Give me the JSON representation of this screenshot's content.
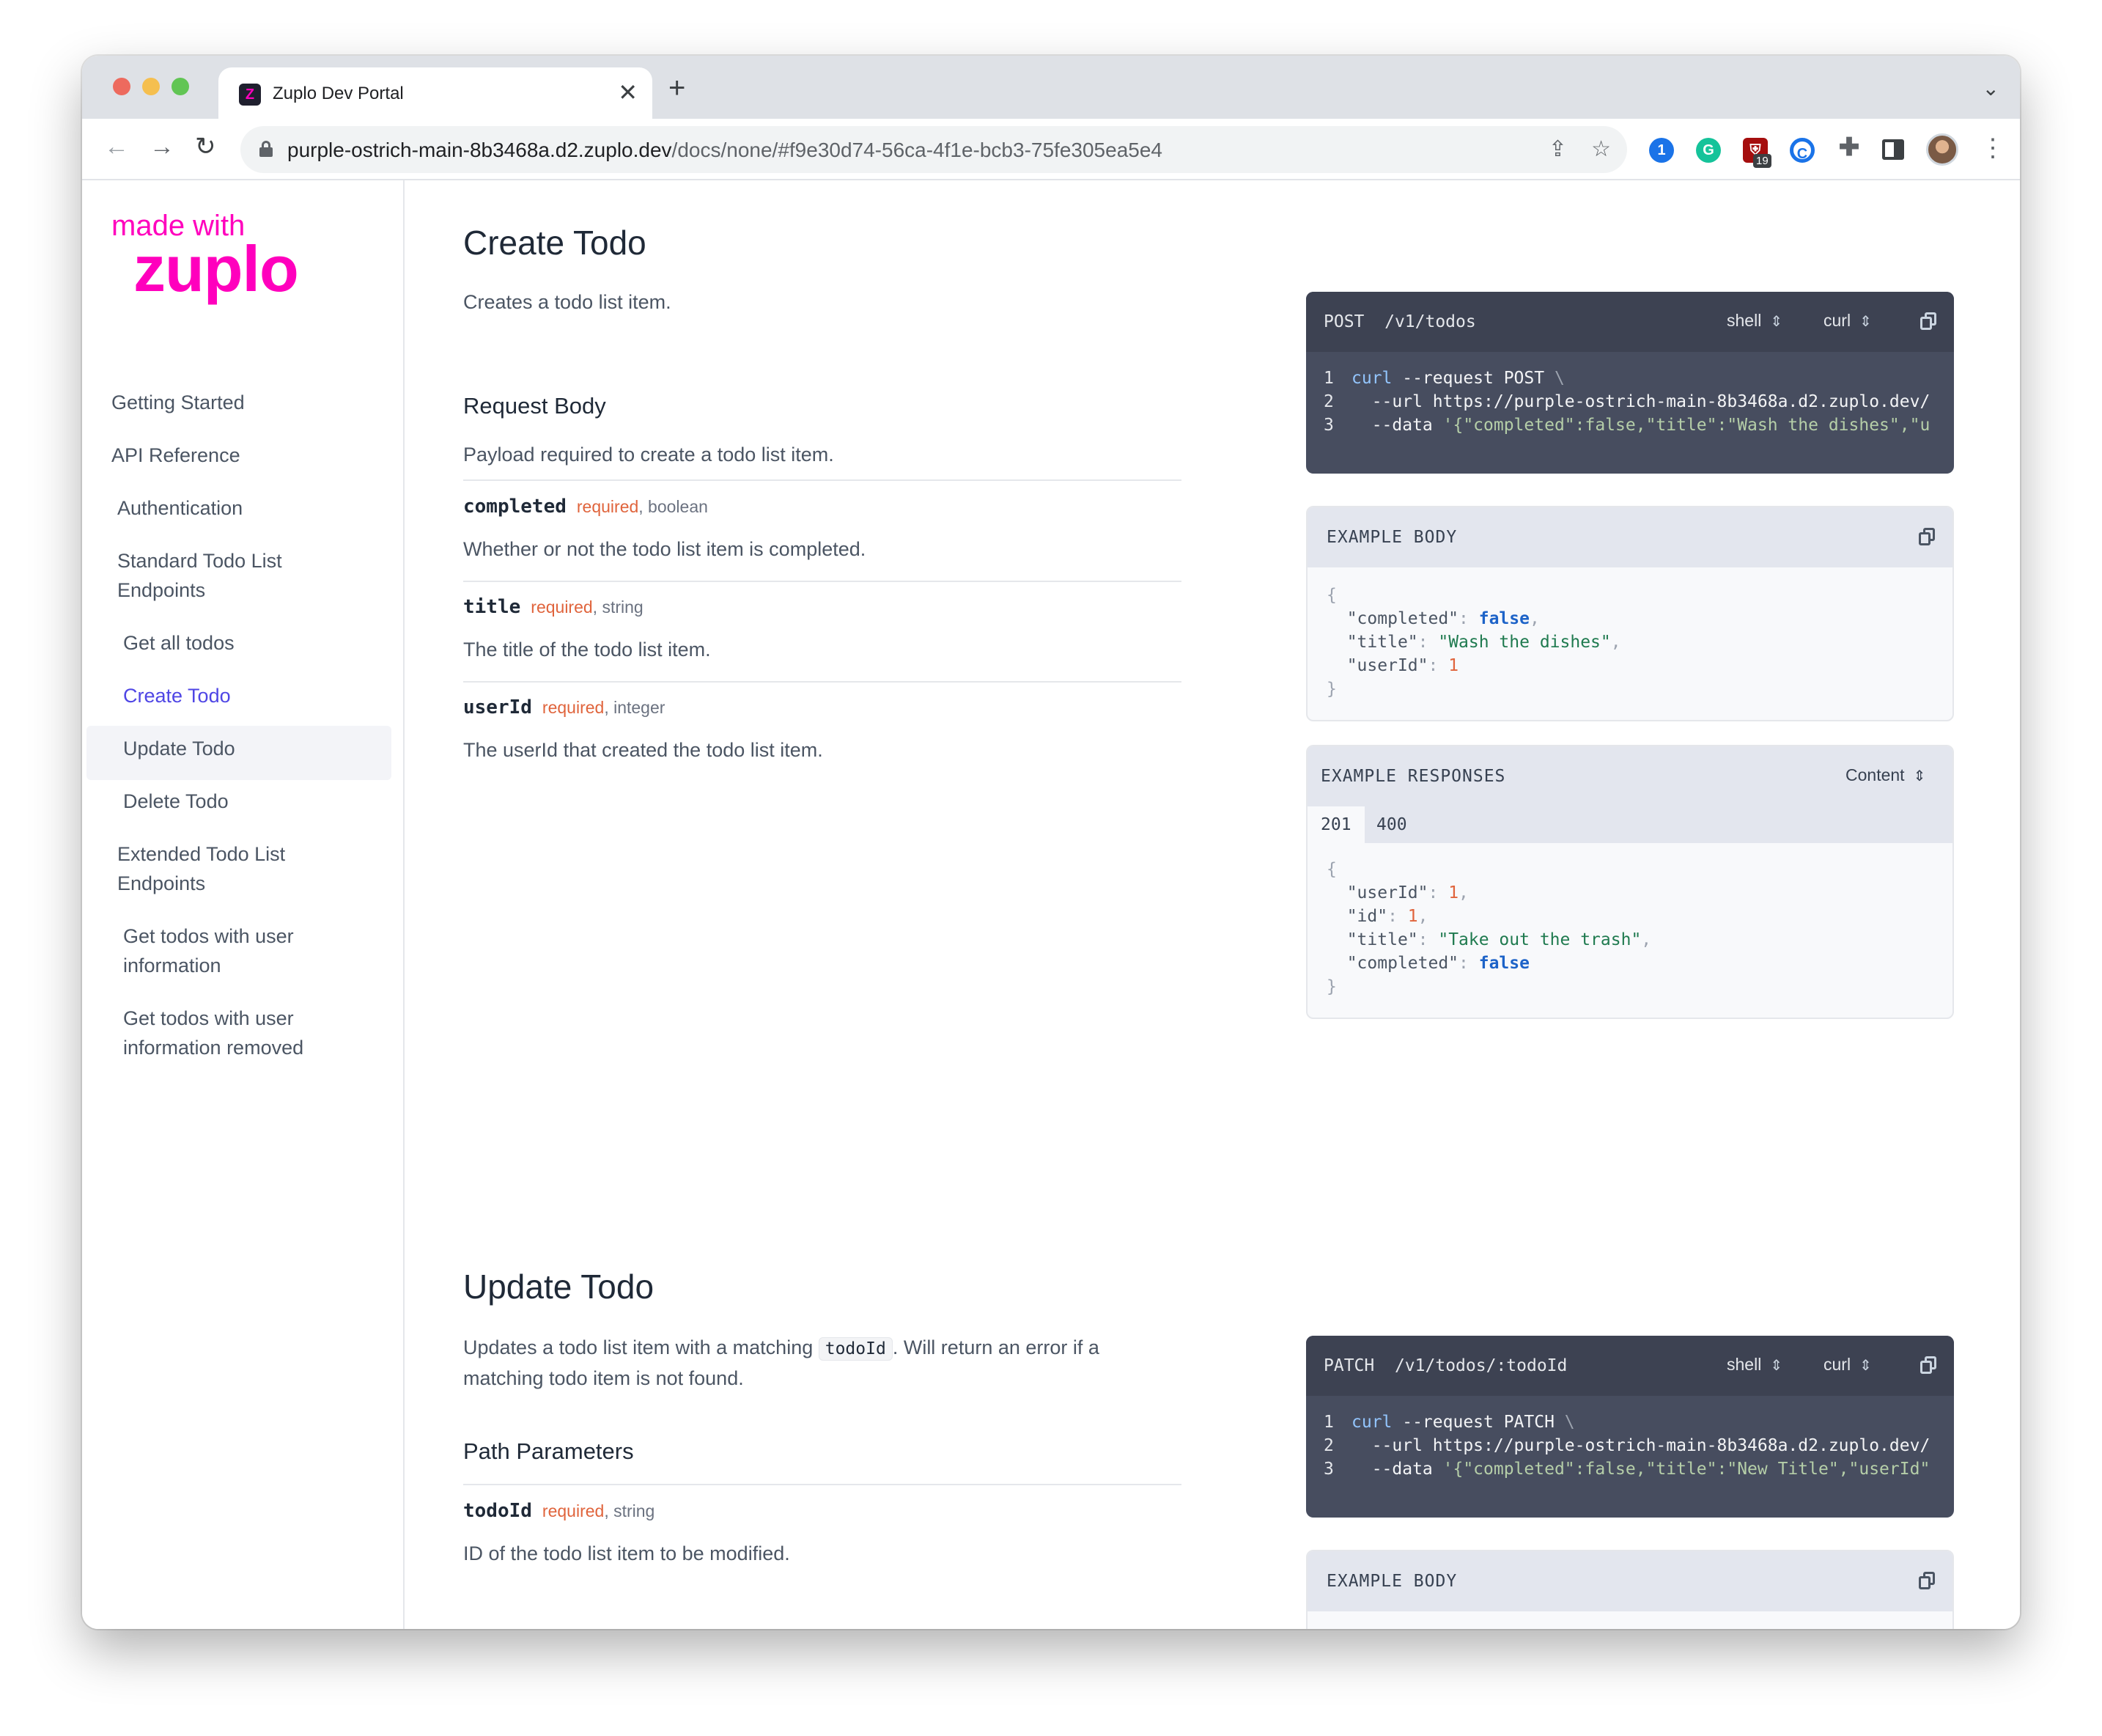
{
  "browser": {
    "tab_title": "Zuplo Dev Portal",
    "tab_close": "✕",
    "new_tab": "+",
    "tabs_menu": "⌄",
    "url_host": "purple-ostrich-main-8b3468a.d2.zuplo.dev",
    "url_path": "/docs/none/#f9e30d74-56ca-4f1e-bcb3-75fe305ea5e4",
    "extension_badge": "19",
    "back": "←",
    "forward": "→",
    "reload": "↻",
    "share": "⇪",
    "star": "☆",
    "menu": "⋮"
  },
  "sidebar": {
    "logo_top": "made with",
    "logo_main": "zuplo",
    "items": [
      {
        "label": "Getting Started"
      },
      {
        "label": "API Reference"
      },
      {
        "label": "Authentication"
      },
      {
        "label": "Standard Todo List Endpoints"
      },
      {
        "label": "Get all todos"
      },
      {
        "label": "Create Todo"
      },
      {
        "label": "Update Todo"
      },
      {
        "label": "Delete Todo"
      },
      {
        "label": "Extended Todo List Endpoints"
      },
      {
        "label": "Get todos with user information"
      },
      {
        "label": "Get todos with user information removed"
      }
    ],
    "active_item": "Create Todo"
  },
  "create_todo": {
    "title": "Create Todo",
    "description": "Creates a todo list item.",
    "request_body_heading": "Request Body",
    "request_body_description": "Payload required to create a todo list item.",
    "fields": [
      {
        "name": "completed",
        "required": "required",
        "type": ", boolean",
        "description": "Whether or not the todo list item is completed."
      },
      {
        "name": "title",
        "required": "required",
        "type": ", string",
        "description": "The title of the todo list item."
      },
      {
        "name": "userId",
        "required": "required",
        "type": ", integer",
        "description": "The userId that created the todo list item."
      }
    ],
    "code": {
      "method": "POST",
      "path": "/v1/todos",
      "lang_select": "shell",
      "client_select": "curl",
      "lines": [
        {
          "num": "1",
          "cmd": "curl",
          "rest": " --request POST ",
          "tail": "\\"
        },
        {
          "num": "2",
          "cmd": "",
          "rest": "  --url https://purple-ostrich-main-8b3468a.d2.zuplo.dev/",
          "tail": ""
        },
        {
          "num": "3",
          "cmd": "",
          "rest": "  --data ",
          "str": "'{\"completed\":false,\"title\":\"Wash the dishes\",\"u"
        }
      ]
    },
    "example_body": {
      "label": "EXAMPLE BODY",
      "open": "{",
      "close": "}",
      "entries": [
        {
          "key": "\"completed\"",
          "value": "false",
          "kind": "bool",
          "comma": ","
        },
        {
          "key": "\"title\"",
          "value": "\"Wash the dishes\"",
          "kind": "str",
          "comma": ","
        },
        {
          "key": "\"userId\"",
          "value": "1",
          "kind": "num",
          "comma": ""
        }
      ]
    },
    "example_responses": {
      "label": "EXAMPLE RESPONSES",
      "content_select": "Content",
      "tabs": [
        "201",
        "400"
      ],
      "selected_tab": "201",
      "open": "{",
      "close": "}",
      "entries": [
        {
          "key": "\"userId\"",
          "value": "1",
          "kind": "num",
          "comma": ","
        },
        {
          "key": "\"id\"",
          "value": "1",
          "kind": "num",
          "comma": ","
        },
        {
          "key": "\"title\"",
          "value": "\"Take out the trash\"",
          "kind": "str",
          "comma": ","
        },
        {
          "key": "\"completed\"",
          "value": "false",
          "kind": "bool",
          "comma": ""
        }
      ]
    }
  },
  "update_todo": {
    "title": "Update Todo",
    "description_before": "Updates a todo list item with a matching ",
    "description_code": "todoId",
    "description_after": ". Will return an error if a",
    "description_line2": "matching todo item is not found.",
    "path_params_heading": "Path Parameters",
    "params": [
      {
        "name": "todoId",
        "required": "required",
        "type": ", string",
        "description": "ID of the todo list item to be modified."
      }
    ],
    "code": {
      "method": "PATCH",
      "path": "/v1/todos/:todoId",
      "lang_select": "shell",
      "client_select": "curl",
      "lines": [
        {
          "num": "1",
          "cmd": "curl",
          "rest": " --request PATCH ",
          "tail": "\\"
        },
        {
          "num": "2",
          "cmd": "",
          "rest": "  --url https://purple-ostrich-main-8b3468a.d2.zuplo.dev/",
          "tail": ""
        },
        {
          "num": "3",
          "cmd": "",
          "rest": "  --data ",
          "str": "'{\"completed\":false,\"title\":\"New Title\",\"userId\""
        }
      ]
    },
    "example_body_label": "EXAMPLE BODY"
  },
  "colors": {
    "brand": "#ff00bd",
    "active_nav": "#4f46e5",
    "required": "#e0643c",
    "code_bg": "#474d5f"
  },
  "icons": [
    "lock-icon",
    "share-icon",
    "star-icon",
    "copy-icon",
    "chevron-updown-icon",
    "puzzle-icon",
    "kebab-icon"
  ]
}
